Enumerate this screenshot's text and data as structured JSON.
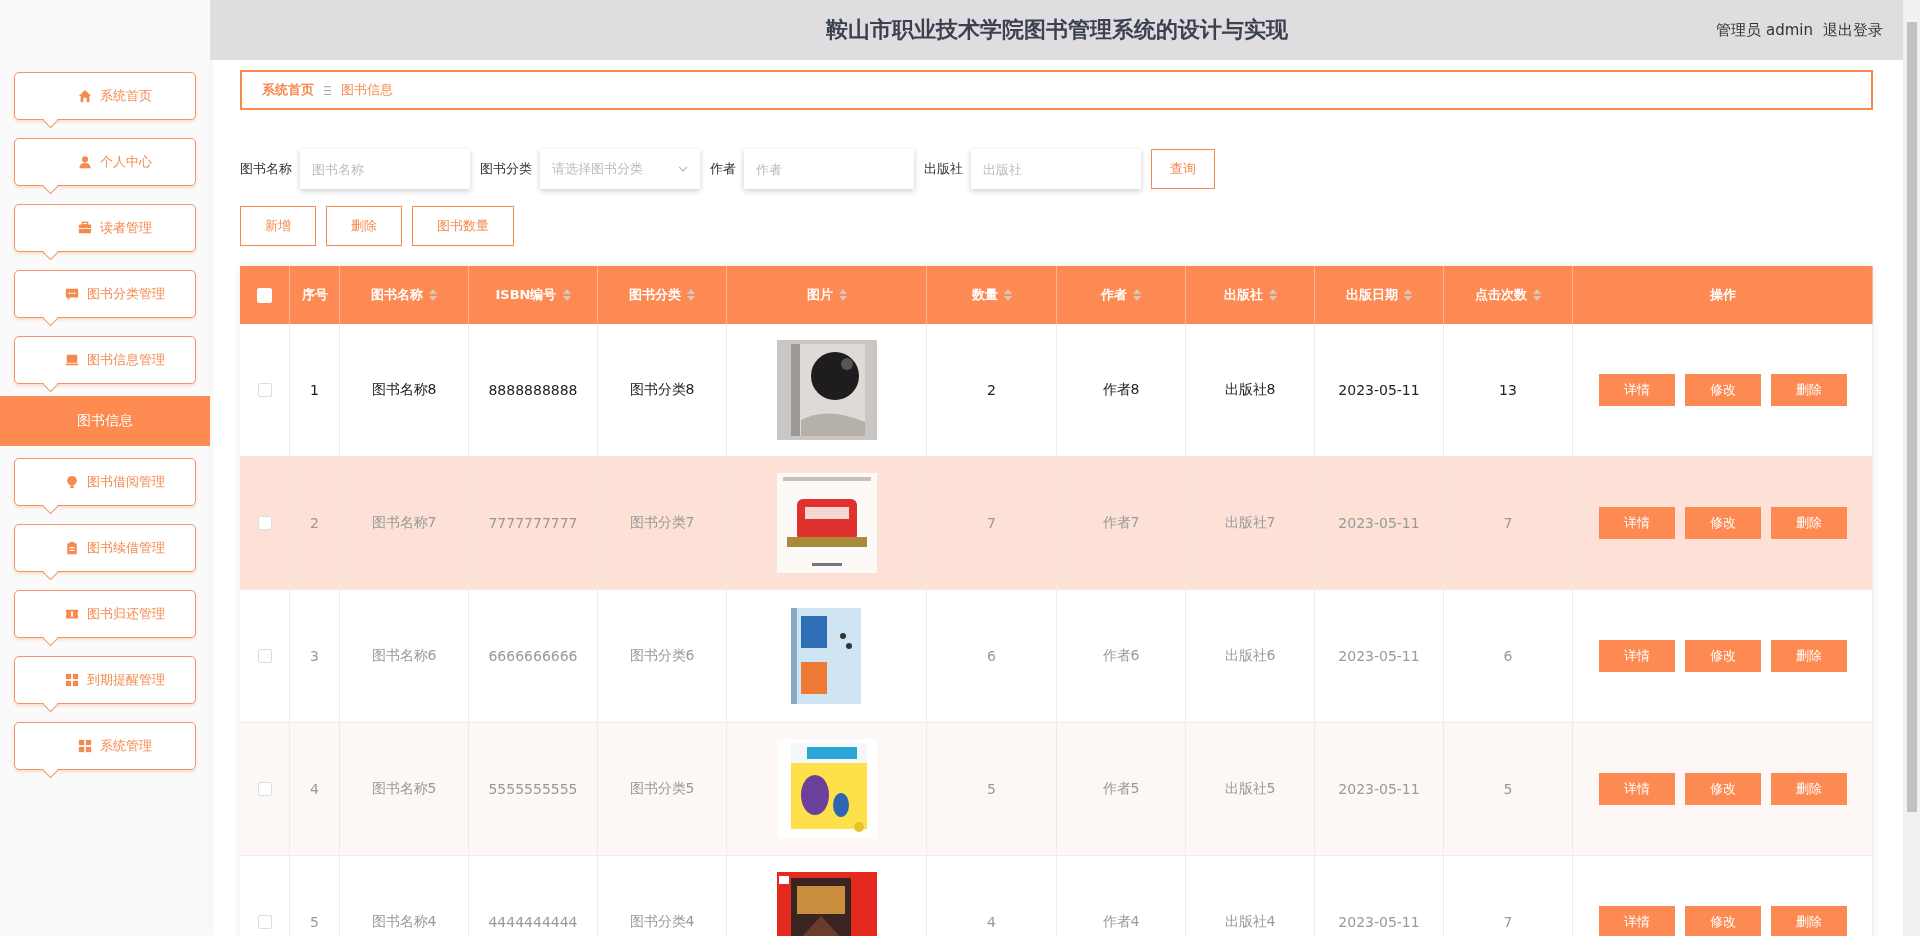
{
  "header": {
    "title": "鞍山市职业技术学院图书管理系统的设计与实现",
    "user": "管理员 admin",
    "logout": "退出登录"
  },
  "sidebar": {
    "items": [
      {
        "label": "系统首页"
      },
      {
        "label": "个人中心"
      },
      {
        "label": "读者管理"
      },
      {
        "label": "图书分类管理"
      },
      {
        "label": "图书信息管理",
        "children": [
          {
            "label": "图书信息",
            "selected": true
          }
        ]
      },
      {
        "label": "图书借阅管理"
      },
      {
        "label": "图书续借管理"
      },
      {
        "label": "图书归还管理"
      },
      {
        "label": "到期提醒管理"
      },
      {
        "label": "系统管理"
      }
    ]
  },
  "breadcrumb": [
    "系统首页",
    "图书信息"
  ],
  "filters": [
    {
      "label": "图书名称",
      "placeholder": "图书名称",
      "kind": "text"
    },
    {
      "label": "图书分类",
      "placeholder": "请选择图书分类",
      "kind": "select"
    },
    {
      "label": "作者",
      "placeholder": "作者",
      "kind": "text"
    },
    {
      "label": "出版社",
      "placeholder": "出版社",
      "kind": "text"
    }
  ],
  "search_button": "查询",
  "actions": [
    "新增",
    "删除",
    "图书数量"
  ],
  "table": {
    "select_all": {
      "checked": false
    },
    "columns": [
      {
        "label": "序号",
        "sortable": false
      },
      {
        "label": "图书名称",
        "sortable": true
      },
      {
        "label": "ISBN编号",
        "sortable": true
      },
      {
        "label": "图书分类",
        "sortable": true
      },
      {
        "label": "图片",
        "sortable": true
      },
      {
        "label": "数量",
        "sortable": true
      },
      {
        "label": "作者",
        "sortable": true
      },
      {
        "label": "出版社",
        "sortable": true
      },
      {
        "label": "出版日期",
        "sortable": true
      },
      {
        "label": "点击次数",
        "sortable": true
      },
      {
        "label": "操作",
        "sortable": false
      }
    ],
    "rows": [
      {
        "checked": false,
        "hovered": false,
        "current": true,
        "index": "1",
        "name": "图书名称8",
        "isbn": "8888888888",
        "category": "图书分类8",
        "image": {
          "kind": "picture"
        },
        "quantity": "2",
        "author": "作者8",
        "publisher": "出版社8",
        "date": "2023-05-11",
        "clicks": "13",
        "buttons": [
          "详情",
          "修改",
          "删除"
        ]
      },
      {
        "checked": false,
        "hovered": true,
        "current": false,
        "index": "2",
        "name": "图书名称7",
        "isbn": "7777777777",
        "category": "图书分类7",
        "image": {
          "kind": "picture"
        },
        "quantity": "7",
        "author": "作者7",
        "publisher": "出版社7",
        "date": "2023-05-11",
        "clicks": "7",
        "buttons": [
          "详情",
          "修改",
          "删除"
        ]
      },
      {
        "checked": false,
        "hovered": false,
        "current": false,
        "index": "3",
        "name": "图书名称6",
        "isbn": "6666666666",
        "category": "图书分类6",
        "image": {
          "kind": "picture"
        },
        "quantity": "6",
        "author": "作者6",
        "publisher": "出版社6",
        "date": "2023-05-11",
        "clicks": "6",
        "buttons": [
          "详情",
          "修改",
          "删除"
        ]
      },
      {
        "checked": false,
        "hovered": false,
        "current": false,
        "index": "4",
        "name": "图书名称5",
        "isbn": "5555555555",
        "category": "图书分类5",
        "image": {
          "kind": "picture"
        },
        "quantity": "5",
        "author": "作者5",
        "publisher": "出版社5",
        "date": "2023-05-11",
        "clicks": "5",
        "buttons": [
          "详情",
          "修改",
          "删除"
        ]
      },
      {
        "checked": false,
        "hovered": false,
        "current": false,
        "index": "5",
        "name": "图书名称4",
        "isbn": "4444444444",
        "category": "图书分类4",
        "image": {
          "kind": "picture"
        },
        "quantity": "4",
        "author": "作者4",
        "publisher": "出版社4",
        "date": "2023-05-11",
        "clicks": "7",
        "buttons": [
          "详情",
          "修改",
          "删除"
        ]
      }
    ]
  }
}
